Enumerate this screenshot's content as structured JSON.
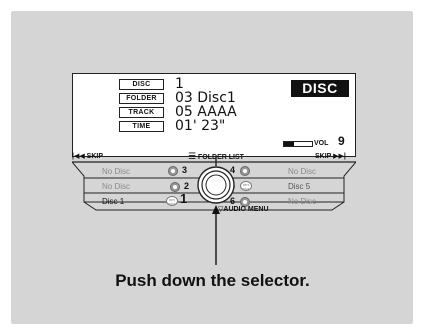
{
  "display": {
    "badge": "DISC",
    "rows": [
      {
        "tag": "DISC",
        "value": "1"
      },
      {
        "tag": "FOLDER",
        "value": "03 Disc1"
      },
      {
        "tag": "TRACK",
        "value": "05 AAAA"
      },
      {
        "tag": "TIME",
        "value": "01' 23\""
      }
    ],
    "volume_label": "VOL",
    "volume_value": "9",
    "volume_level_fraction": 0.35
  },
  "menu": {
    "skip_back": "SKIP",
    "skip_forward": "SKIP",
    "folder_list": "FOLDER LIST",
    "audio_menu": "AUDIO MENU",
    "slots": [
      {
        "number": "1",
        "label": "Disc 1",
        "status": "active",
        "icon": "mp3-wma-icon"
      },
      {
        "number": "2",
        "label": "No Disc",
        "status": "empty",
        "icon": "disc-icon"
      },
      {
        "number": "3",
        "label": "No Disc",
        "status": "empty",
        "icon": "disc-icon"
      },
      {
        "number": "4",
        "label": "No Disc",
        "status": "empty",
        "icon": "disc-icon"
      },
      {
        "number": "5",
        "label": "Disc 5",
        "status": "loaded",
        "icon": "mp3-wma-icon"
      },
      {
        "number": "6",
        "label": "No Disc",
        "status": "empty",
        "icon": "disc-icon"
      }
    ]
  },
  "instruction": "Push down the selector.",
  "colors": {
    "panel": "#d5d5d5",
    "badge": "#111111",
    "empty_text": "#8a8a8a"
  }
}
